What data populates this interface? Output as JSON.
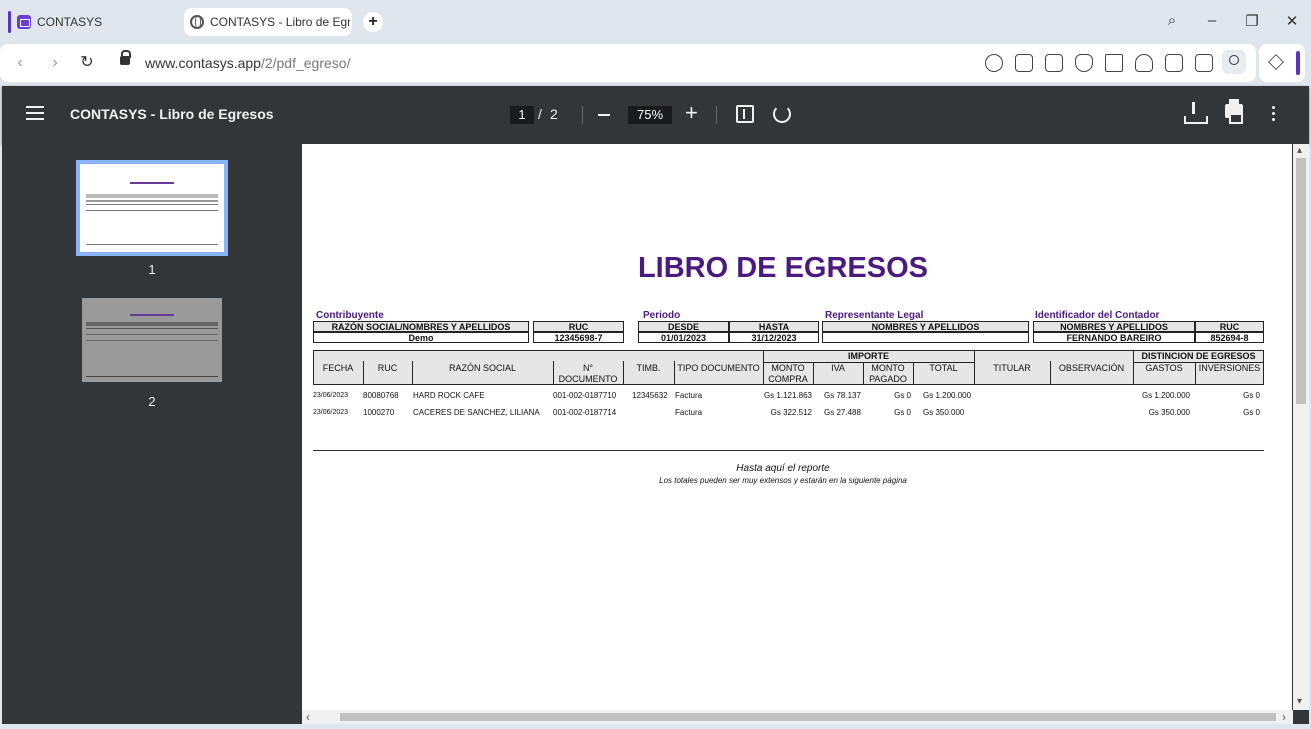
{
  "browser": {
    "tabs": [
      {
        "title": "CONTASYS"
      },
      {
        "title": "CONTASYS - Libro de Egresos"
      }
    ],
    "url_host": "www.contasys.app",
    "url_path": "/2/pdf_egreso/"
  },
  "viewer": {
    "title": "CONTASYS - Libro de Egresos",
    "current_page": "1",
    "separator": "/",
    "total_pages": "2",
    "zoom": "75%",
    "thumbnails": [
      {
        "label": "1"
      },
      {
        "label": "2"
      }
    ]
  },
  "report": {
    "title": "LIBRO DE EGRESOS",
    "contribuyente": {
      "label": "Contribuyente",
      "name_header": "RAZÓN SOCIAL/NOMBRES Y APELLIDOS",
      "ruc_header": "RUC",
      "name": "Demo",
      "ruc": "12345698-7"
    },
    "periodo": {
      "label": "Periodo",
      "desde_header": "DESDE",
      "hasta_header": "HASTA",
      "desde": "01/01/2023",
      "hasta": "31/12/2023"
    },
    "representante": {
      "label": "Representante Legal",
      "header": "NOMBRES Y APELLIDOS",
      "value": ""
    },
    "contador": {
      "label": "Identificador del Contador",
      "name_header": "NOMBRES Y APELLIDOS",
      "ruc_header": "RUC",
      "name": "FERNANDO BAREIRO",
      "ruc": "852694-8"
    },
    "group_headers": {
      "importe": "IMPORTE",
      "distincion": "DISTINCION DE EGRESOS"
    },
    "columns": {
      "fecha": "FECHA",
      "ruc": "RUC",
      "razon": "RAZÓN SOCIAL",
      "doc_line1": "N°",
      "doc_line2": "DOCUMENTO",
      "timb": "TIMB.",
      "tipo": "TIPO DOCUMENTO",
      "compra_line1": "MONTO",
      "compra_line2": "COMPRA",
      "iva": "IVA",
      "pagado_line1": "MONTO",
      "pagado_line2": "PAGADO",
      "total": "TOTAL",
      "titular": "TITULAR",
      "observacion": "OBSERVACIÓN",
      "gastos": "GASTOS",
      "inversiones": "INVERSIONES"
    },
    "rows": [
      {
        "fecha": "23/06/2023",
        "ruc": "80080768",
        "razon": "HARD ROCK CAFE",
        "documento": "001-002-0187710",
        "timbrado": "12345632",
        "tipo": "Factura",
        "monto_compra": "Gs 1.121.863",
        "iva": "Gs 78.137",
        "monto_pagado": "Gs 0",
        "total": "Gs 1.200.000",
        "gastos": "Gs 1.200.000",
        "inversiones": "Gs 0"
      },
      {
        "fecha": "23/06/2023",
        "ruc": "1000270",
        "razon": "CACERES DE SANCHEZ, LILIANA",
        "documento": "001-002-0187714",
        "timbrado": "",
        "tipo": "Factura",
        "monto_compra": "Gs 322.512",
        "iva": "Gs 27.488",
        "monto_pagado": "Gs 0",
        "total": "Gs 350.000",
        "gastos": "Gs 350.000",
        "inversiones": "Gs 0"
      }
    ],
    "footer_line1": "Hasta aquí el reporte",
    "footer_line2": "Los totales pueden ser muy extensos y estarán en la siguiente página"
  }
}
